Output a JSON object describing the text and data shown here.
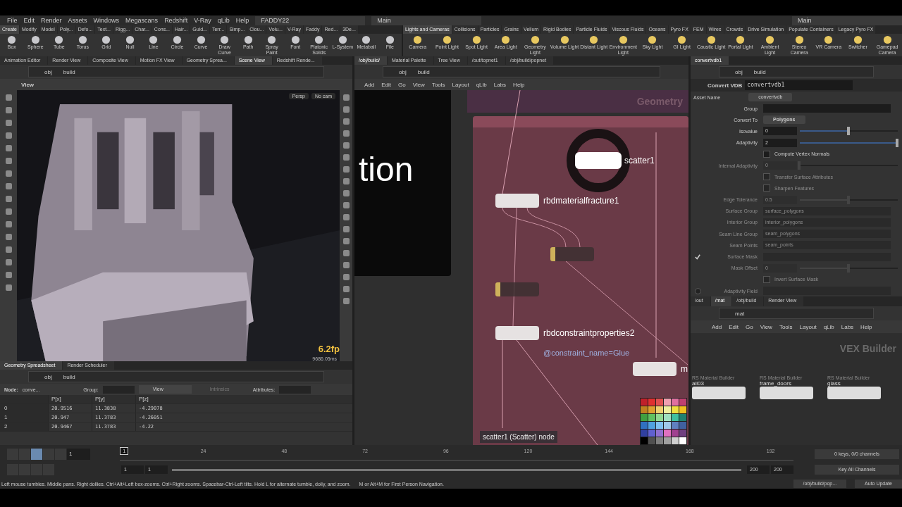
{
  "menu": [
    "File",
    "Edit",
    "Render",
    "Assets",
    "Windows",
    "Megascans",
    "Redshift",
    "V-Ray",
    "qLib",
    "Help"
  ],
  "desktop": "FADDY22",
  "main": "Main",
  "main_right": "Main",
  "shelf_left": {
    "tabs": [
      {
        "label": "Create",
        "selected": true
      },
      {
        "label": "Modify",
        "selected": false
      },
      {
        "label": "Model",
        "selected": false
      },
      {
        "label": "Poly...",
        "selected": false
      },
      {
        "label": "Defo...",
        "selected": false
      },
      {
        "label": "Text...",
        "selected": false
      },
      {
        "label": "Rigg...",
        "selected": false
      },
      {
        "label": "Char...",
        "selected": false
      },
      {
        "label": "Cons...",
        "selected": false
      },
      {
        "label": "Hair...",
        "selected": false
      },
      {
        "label": "Guid...",
        "selected": false
      },
      {
        "label": "Terr...",
        "selected": false
      },
      {
        "label": "Simp...",
        "selected": false
      },
      {
        "label": "Clou...",
        "selected": false
      },
      {
        "label": "Volu...",
        "selected": false
      },
      {
        "label": "V-Ray",
        "selected": false
      },
      {
        "label": "Faddy",
        "selected": false
      },
      {
        "label": "Red...",
        "selected": false
      },
      {
        "label": "3De...",
        "selected": false
      }
    ],
    "tools": [
      "Box",
      "Sphere",
      "Tube",
      "Torus",
      "Grid",
      "Null",
      "Line",
      "Circle",
      "Curve",
      "Draw Curve",
      "Path",
      "Spray Paint",
      "Font",
      "Platonic Solids",
      "L-System",
      "Metaball",
      "File"
    ]
  },
  "shelf_right": {
    "tabs": [
      {
        "label": "Lights and Cameras",
        "selected": true
      },
      {
        "label": "Collisions",
        "selected": false
      },
      {
        "label": "Particles",
        "selected": false
      },
      {
        "label": "Grains",
        "selected": false
      },
      {
        "label": "Vellum",
        "selected": false
      },
      {
        "label": "Rigid Bodies",
        "selected": false
      },
      {
        "label": "Particle Fluids",
        "selected": false
      },
      {
        "label": "Viscous Fluids",
        "selected": false
      },
      {
        "label": "Oceans",
        "selected": false
      },
      {
        "label": "Pyro FX",
        "selected": false
      },
      {
        "label": "FEM",
        "selected": false
      },
      {
        "label": "Wires",
        "selected": false
      },
      {
        "label": "Crowds",
        "selected": false
      },
      {
        "label": "Drive Simulation",
        "selected": false
      },
      {
        "label": "Populate Containers",
        "selected": false
      },
      {
        "label": "Legacy Pyro FX",
        "selected": false
      }
    ],
    "tools": [
      "Camera",
      "Point Light",
      "Spot Light",
      "Area Light",
      "Geometry Light",
      "Volume Light",
      "Distant Light",
      "Environment Light",
      "Sky Light",
      "GI Light",
      "Caustic Light",
      "Portal Light",
      "Ambient Light",
      "Stereo Camera",
      "VR Camera",
      "Switcher",
      "Gamepad Camera"
    ]
  },
  "scene_pane": {
    "tabs": [
      {
        "label": "Animation Editor",
        "selected": false
      },
      {
        "label": "Render View",
        "selected": false
      },
      {
        "label": "Composite View",
        "selected": false
      },
      {
        "label": "Motion FX View",
        "selected": false
      },
      {
        "label": "Geometry Sprea...",
        "selected": false
      },
      {
        "label": "Scene View",
        "selected": true
      },
      {
        "label": "Redshift Rende...",
        "selected": false
      }
    ],
    "path": [
      "obj",
      "build"
    ],
    "view_label": "View",
    "camera_menus": [
      "Persp",
      "No cam"
    ],
    "fps": "6.2fp",
    "timing": "9686.05ms"
  },
  "spreadsheet": {
    "tabs": [
      {
        "label": "Geometry Spreadsheet",
        "selected": true
      },
      {
        "label": "Render Scheduler",
        "selected": false
      }
    ],
    "path": [
      "obj",
      "build"
    ],
    "node_label": "Node:",
    "node_value": "conve...",
    "group_label": "Group:",
    "view_menu": "View",
    "intrinsics_menu": "Intrinsics",
    "attributes_label": "Attributes:",
    "columns": [
      "P[x]",
      "P[y]",
      "P[z]"
    ],
    "rows": [
      {
        "index": "0",
        "cells": [
          "20.9516",
          "11.3838",
          "-4.29078"
        ]
      },
      {
        "index": "1",
        "cells": [
          "20.947",
          "11.3783",
          "-4.26051"
        ]
      },
      {
        "index": "2",
        "cells": [
          "20.9467",
          "11.3783",
          "-4.22"
        ]
      }
    ]
  },
  "network": {
    "tabs": [
      {
        "label": "/obj/build/",
        "selected": true
      },
      {
        "label": "Material Palette",
        "selected": false
      },
      {
        "label": "Tree View",
        "selected": false
      },
      {
        "label": "/out/topnet1",
        "selected": false
      },
      {
        "label": "/obj/build/popnet",
        "selected": false
      }
    ],
    "path": [
      "obj",
      "build"
    ],
    "menu": [
      "Add",
      "Edit",
      "Go",
      "View",
      "Tools",
      "Layout",
      "qLib",
      "Labs",
      "Help"
    ],
    "overlay_text": "tion",
    "context_label": "Geometry",
    "nodes": [
      {
        "label": "scatter1",
        "selected": true,
        "bypassed": false
      },
      {
        "label": "rbdmaterialfracture1",
        "selected": false,
        "bypassed": false
      },
      {
        "selected": false,
        "bypassed": true
      },
      {
        "selected": false,
        "bypassed": true
      },
      {
        "label": "rbdconstraintproperties2",
        "selected": false,
        "bypassed": false
      },
      {
        "label": "m",
        "selected": false,
        "bypassed": false
      }
    ],
    "comment": "@constraint_name=Glue",
    "tooltip": "scatter1 (Scatter) node",
    "palette": [
      {
        "color": "#c0202a"
      },
      {
        "color": "#e03030"
      },
      {
        "color": "#e05050"
      },
      {
        "color": "#f0a0b0"
      },
      {
        "color": "#e070a0"
      },
      {
        "color": "#c04070"
      },
      {
        "color": "#c08020"
      },
      {
        "color": "#e0a030"
      },
      {
        "color": "#f0d070"
      },
      {
        "color": "#f0f0a0"
      },
      {
        "color": "#f0e040"
      },
      {
        "color": "#f0c020"
      },
      {
        "color": "#40a040"
      },
      {
        "color": "#60c060"
      },
      {
        "color": "#90d890"
      },
      {
        "color": "#a0e0c0"
      },
      {
        "color": "#40c0a0"
      },
      {
        "color": "#208070"
      },
      {
        "color": "#3070c0"
      },
      {
        "color": "#50a0e0"
      },
      {
        "color": "#80c0f0"
      },
      {
        "color": "#a0c8e8"
      },
      {
        "color": "#6080c0"
      },
      {
        "color": "#4060a0"
      },
      {
        "color": "#3040a0"
      },
      {
        "color": "#6060d0"
      },
      {
        "color": "#9070d0"
      },
      {
        "color": "#e070c0"
      },
      {
        "color": "#a04090"
      },
      {
        "color": "#704080"
      },
      {
        "color": "#000000"
      },
      {
        "color": "#505050"
      },
      {
        "color": "#808080"
      },
      {
        "color": "#a0a0a0"
      },
      {
        "color": "#d0d0d0"
      },
      {
        "color": "#ffffff"
      }
    ]
  },
  "parameters": {
    "tabs": [
      {
        "label": "convertvdb1",
        "selected": true
      }
    ],
    "path": [
      "obj",
      "build"
    ],
    "node_type": "Convert VDB",
    "node_name": "convertvdb1",
    "asset_label": "Asset Name",
    "asset_value": "convertvdb",
    "params": [
      {
        "kind": "field",
        "label": "Group",
        "disabled": false
      },
      {
        "kind": "menu",
        "label": "Convert To",
        "value": "Polygons",
        "disabled": false
      },
      {
        "kind": "slider",
        "label": "Isovalue",
        "value": "0",
        "level": 0.5,
        "disabled": false
      },
      {
        "kind": "slider",
        "label": "Adaptivity",
        "value": "2",
        "level": 1,
        "disabled": false
      },
      {
        "kind": "checkbox",
        "label": "Compute Vertex Normals",
        "checked": false,
        "disabled": false
      },
      {
        "kind": "slider",
        "label": "Internal Adaptivity",
        "value": "0",
        "level": 0,
        "disabled": true
      },
      {
        "kind": "checkbox",
        "label": "Transfer Surface Attributes",
        "checked": false,
        "disabled": true
      },
      {
        "kind": "checkbox",
        "label": "Sharpen Features",
        "checked": false,
        "disabled": true
      },
      {
        "kind": "slider",
        "label": "Edge Tolerance",
        "value": "0.5",
        "level": 0.5,
        "disabled": true
      },
      {
        "kind": "field",
        "label": "Surface Group",
        "value": "surface_polygons",
        "disabled": true
      },
      {
        "kind": "field",
        "label": "Interior Group",
        "value": "interior_polygons",
        "disabled": true
      },
      {
        "kind": "field",
        "label": "Seam Line Group",
        "value": "seam_polygons",
        "disabled": true
      },
      {
        "kind": "field",
        "label": "Seam Points",
        "value": "seam_points",
        "disabled": true
      },
      {
        "kind": "field",
        "label": "Surface Mask",
        "toggle": true,
        "disabled": true
      },
      {
        "kind": "slider",
        "label": "Mask Offset",
        "value": "0",
        "level": 0.5,
        "disabled": true
      },
      {
        "kind": "checkbox",
        "label": "Invert Surface Mask",
        "checked": false,
        "disabled": true
      },
      {
        "kind": "field",
        "label": "Adaptivity Field",
        "toggle": false,
        "disabled": true
      }
    ]
  },
  "materials": {
    "tabs": [
      {
        "label": "/out",
        "selected": false
      },
      {
        "label": "/mat",
        "selected": true
      },
      {
        "label": "/obj/build",
        "selected": false
      },
      {
        "label": "Render View",
        "selected": false
      }
    ],
    "path": [
      "mat"
    ],
    "menu": [
      "Add",
      "Edit",
      "Go",
      "View",
      "Tools",
      "Layout",
      "qLib",
      "Labs",
      "Help"
    ],
    "context_label": "VEX Builder",
    "nodes": [
      {
        "type": "RS Material Builder",
        "label": "all03"
      },
      {
        "type": "RS Material Builder",
        "label": "frame_doors"
      },
      {
        "type": "RS Material Builder",
        "label": "glass"
      }
    ]
  },
  "timeline": {
    "range": {
      "level": 1
    },
    "frame": "1",
    "marker": "1",
    "ticks": [
      "24",
      "48",
      "72",
      "96",
      "120",
      "144",
      "168",
      "192"
    ],
    "range_start": [
      "1",
      "1"
    ],
    "range_end": [
      "200",
      "200"
    ],
    "keys": "0 keys, 0/0 channels",
    "key_all": "Key All Channels"
  },
  "status": {
    "hint": "Left mouse tumbles. Middle pans. Right dollies. Ctrl+Alt+Left box-zooms. Ctrl+Right zooms. Spacebar-Ctrl-Left tilts. Hold L for alternate tumble, dolly, and zoom.",
    "hint2": "M or Alt+M for First Person Navigation.",
    "path": "/obj/build/pop...",
    "update": "Auto Update"
  }
}
